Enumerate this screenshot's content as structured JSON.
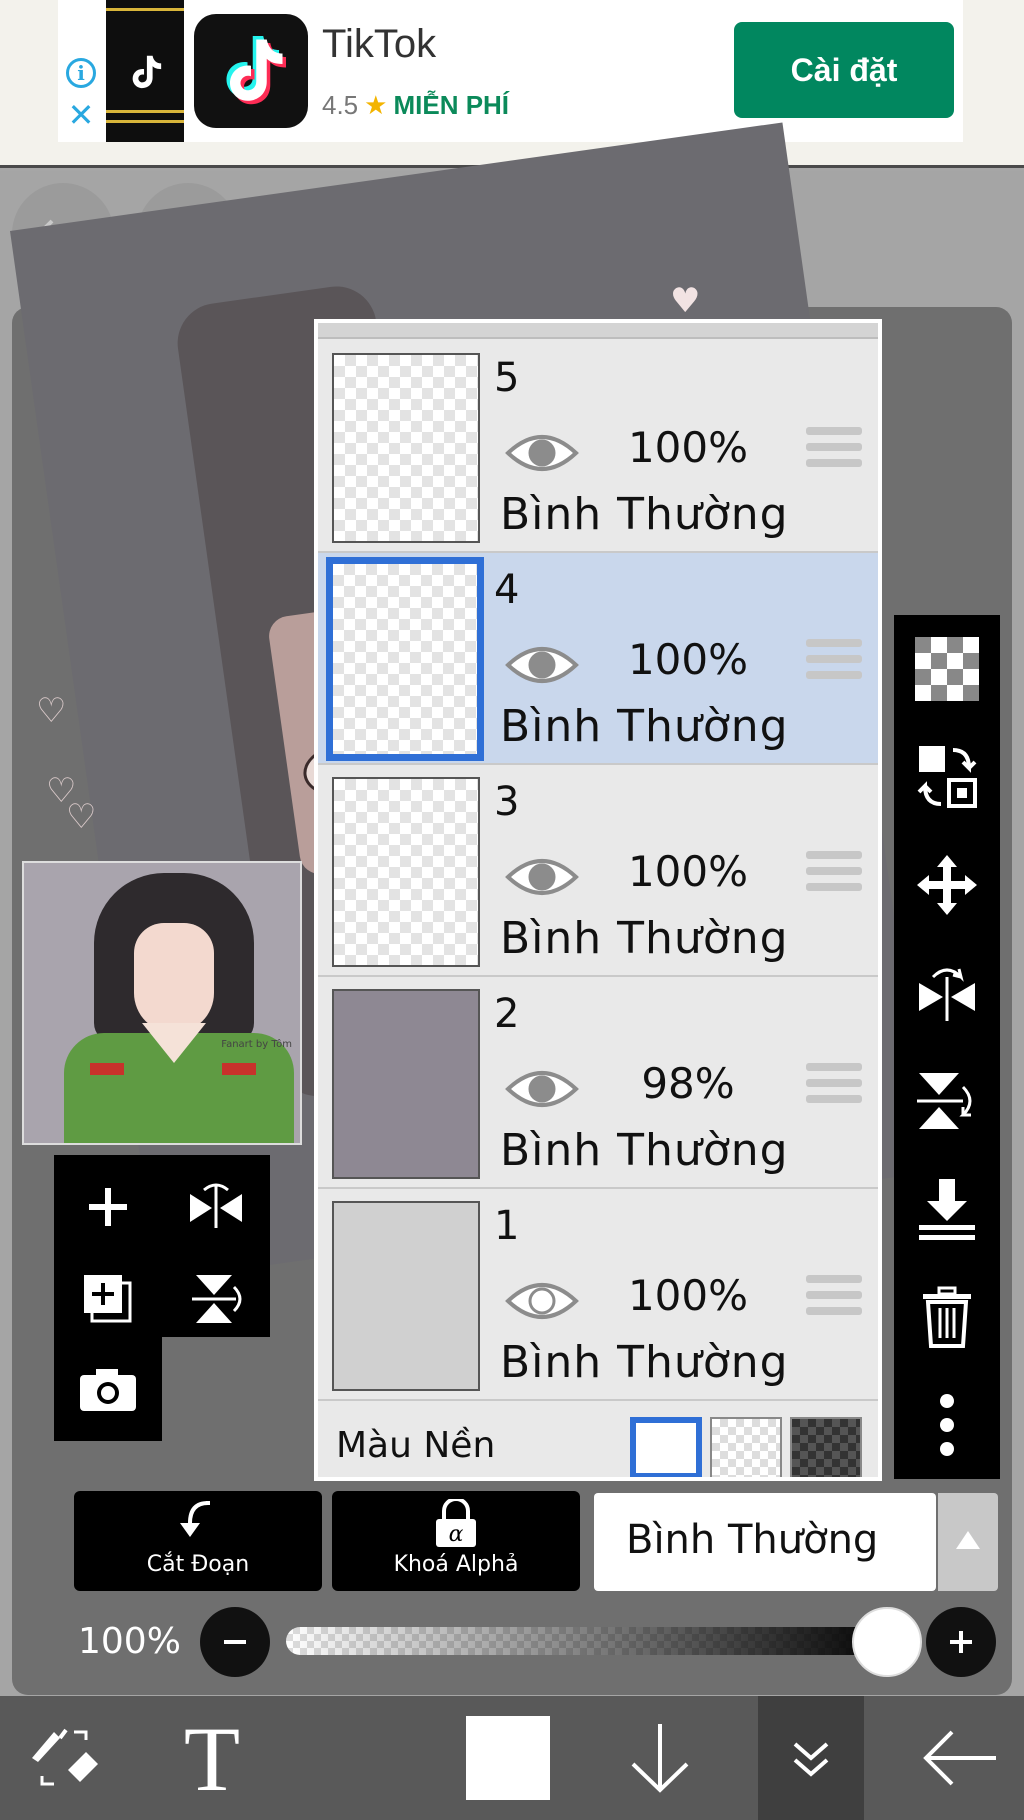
{
  "ad": {
    "info_glyph": "i",
    "close_glyph": "✕",
    "app_name": "TikTok",
    "rating": "4.5",
    "star": "★",
    "price": "MIỄN PHÍ",
    "install_label": "Cài đặt"
  },
  "canvas": {
    "thumbnail_signature": "Fanart by Tôm"
  },
  "layers_panel": {
    "layers": [
      {
        "number": "5",
        "opacity": "100%",
        "blend_mode": "Bình Thường",
        "visible": true,
        "selected": false,
        "thumb": "transparent"
      },
      {
        "number": "4",
        "opacity": "100%",
        "blend_mode": "Bình Thường",
        "visible": true,
        "selected": true,
        "thumb": "transparent"
      },
      {
        "number": "3",
        "opacity": "100%",
        "blend_mode": "Bình Thường",
        "visible": true,
        "selected": false,
        "thumb": "transparent"
      },
      {
        "number": "2",
        "opacity": "98%",
        "blend_mode": "Bình Thường",
        "visible": true,
        "selected": false,
        "thumb": "fill"
      },
      {
        "number": "1",
        "opacity": "100%",
        "blend_mode": "Bình Thường",
        "visible": true,
        "selected": false,
        "thumb": "sketch"
      }
    ],
    "background_label": "Màu Nền"
  },
  "controls": {
    "clipping_label": "Cắt Đoạn",
    "alpha_lock_label": "Khoá Alphả",
    "blend_mode": "Bình Thường",
    "opacity_label": "100%",
    "opacity_value": 1.0
  },
  "colors": {
    "accent_blue": "#2f6fd6",
    "selected_layer_bg": "#c9d7ec",
    "install_green": "#01875f"
  },
  "icons": {
    "left_tools": [
      "add-layer-icon",
      "flip-horizontal-icon",
      "duplicate-layer-icon",
      "flip-vertical-icon",
      "camera-icon"
    ],
    "right_tools": [
      "transparency-icon",
      "swap-icon",
      "move-icon",
      "flip-horizontal-icon",
      "flip-vertical-rotate-icon",
      "merge-down-icon",
      "trash-icon",
      "more-icon"
    ],
    "bottom_nav": [
      "tool-switch-icon",
      "text-tool-icon",
      "color-swatch-icon",
      "arrow-down-icon",
      "collapse-icon",
      "back-arrow-icon"
    ]
  }
}
